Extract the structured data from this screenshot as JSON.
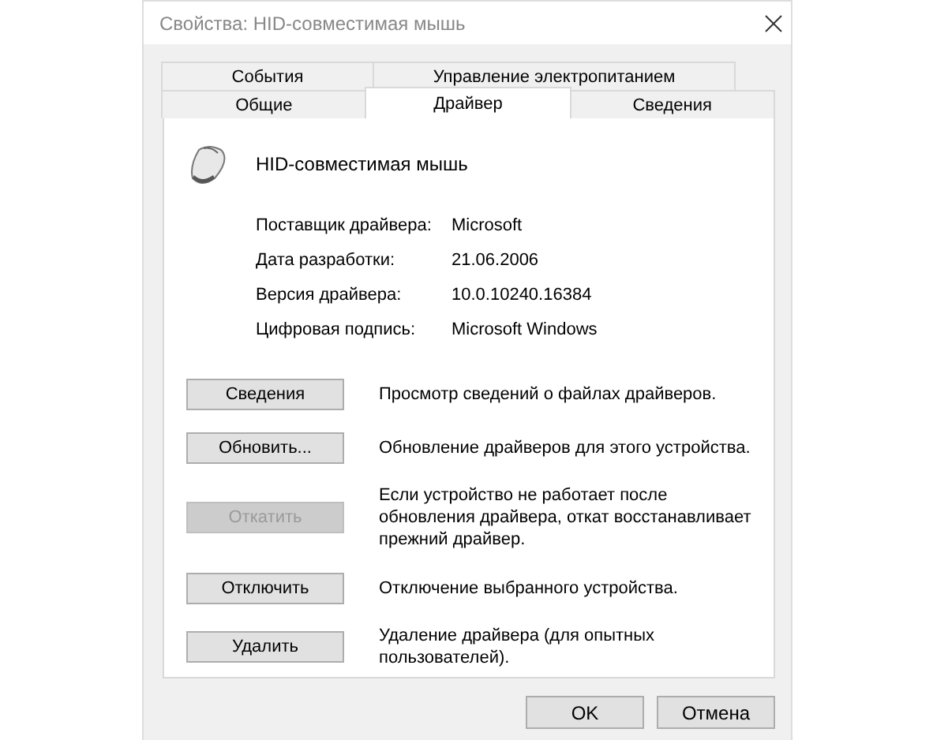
{
  "window": {
    "title": "Свойства: HID-совместимая мышь"
  },
  "tab_rows": [
    [
      {
        "label": "События",
        "selected": false
      },
      {
        "label": "Управление электропитанием",
        "selected": false
      }
    ],
    [
      {
        "label": "Общие",
        "selected": false
      },
      {
        "label": "Драйвер",
        "selected": true
      },
      {
        "label": "Сведения",
        "selected": false
      }
    ]
  ],
  "device": {
    "name": "HID-совместимая мышь"
  },
  "properties": [
    {
      "label": "Поставщик драйвера:",
      "value": "Microsoft"
    },
    {
      "label": "Дата разработки:",
      "value": "21.06.2006"
    },
    {
      "label": "Версия драйвера:",
      "value": "10.0.10240.16384"
    },
    {
      "label": "Цифровая подпись:",
      "value": "Microsoft Windows"
    }
  ],
  "actions": [
    {
      "button": "Сведения",
      "disabled": false,
      "description": "Просмотр сведений о файлах драйверов."
    },
    {
      "button": "Обновить...",
      "disabled": false,
      "description": "Обновление драйверов для этого устройства."
    },
    {
      "button": "Откатить",
      "disabled": true,
      "description": "Если устройство не работает после обновления драйвера, откат восстанавливает прежний драйвер."
    },
    {
      "button": "Отключить",
      "disabled": false,
      "description": "Отключение выбранного устройства."
    },
    {
      "button": "Удалить",
      "disabled": false,
      "description": "Удаление драйвера (для опытных пользователей)."
    }
  ],
  "buttons": [
    "OK",
    "Отмена"
  ]
}
